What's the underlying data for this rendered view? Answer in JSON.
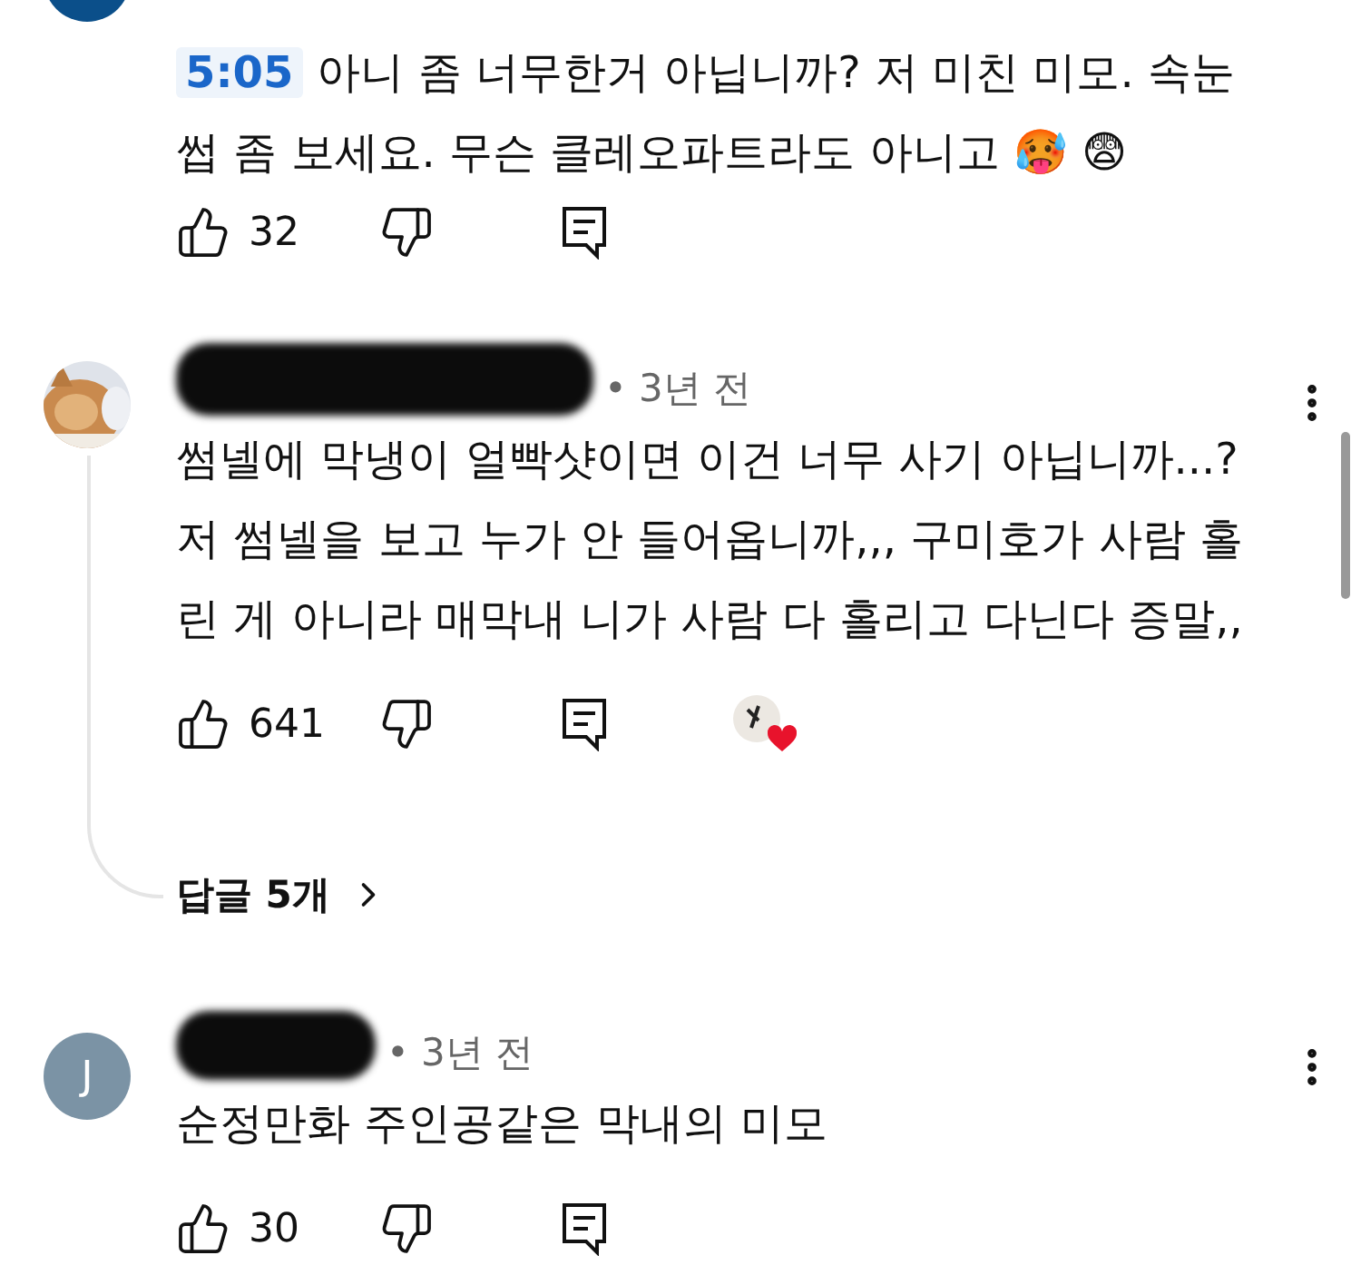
{
  "comments": [
    {
      "avatar": {
        "kind": "plain",
        "color": "#0b4f8a"
      },
      "timestamp": "5:05",
      "text": "아니 좀 너무한거 아닙니까? 저 미친 미모. 속눈썹 좀 보세요. 무슨 클레오파트라도 아니고 🥵 😨",
      "likes": "32",
      "creator_heart": false
    },
    {
      "meta": "• 3년 전",
      "redacted": true,
      "text": "썸넬에 막냉이 얼빡샷이면 이건 너무 사기 아닙니까...? 저 썸넬을 보고 누가 안 들어옵니까,,, 구미호가 사람 홀린 게 아니라 매막내 니가 사람 다 홀리고 다닌다 증말,,",
      "likes": "641",
      "creator_heart": true,
      "replies": "답글 5개"
    },
    {
      "avatar": {
        "kind": "letter",
        "letter": "J",
        "color": "#7b93a5"
      },
      "meta": "• 3년 전",
      "redacted": true,
      "text": "순정만화 주인공같은 막내의 미모",
      "likes": "30",
      "creator_heart": false
    }
  ]
}
